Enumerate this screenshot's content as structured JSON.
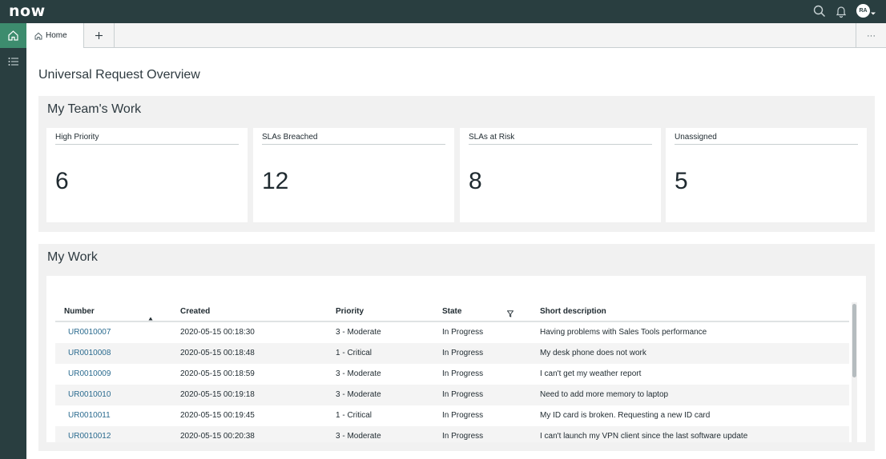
{
  "app": {
    "logo_text": "now",
    "avatar_initials": "RA"
  },
  "icons": {
    "search": "search-icon",
    "bell": "bell-icon",
    "home": "home-icon",
    "list": "list-icon",
    "add": "plus-icon",
    "more": "more-icon",
    "sort": "sort-ascending-icon",
    "filter": "filter-icon"
  },
  "colors": {
    "topbar": "#293e40",
    "rail_active": "#3d8c6e",
    "link": "#2b6b8f"
  },
  "tabs": {
    "home_label": "Home",
    "more_label": "···"
  },
  "page": {
    "title": "Universal Request Overview"
  },
  "team": {
    "title": "My Team's Work",
    "cards": [
      {
        "label": "High Priority",
        "value": "6"
      },
      {
        "label": "SLAs Breached",
        "value": "12"
      },
      {
        "label": "SLAs at Risk",
        "value": "8"
      },
      {
        "label": "Unassigned",
        "value": "5"
      }
    ]
  },
  "work": {
    "title": "My Work",
    "columns": [
      "Number",
      "Created",
      "Priority",
      "State",
      "Short description"
    ],
    "rows": [
      {
        "number": "UR0010007",
        "created": "2020-05-15 00:18:30",
        "priority": "3 - Moderate",
        "state": "In Progress",
        "desc": "Having problems with Sales Tools performance"
      },
      {
        "number": "UR0010008",
        "created": "2020-05-15 00:18:48",
        "priority": "1 - Critical",
        "state": "In Progress",
        "desc": "My desk phone does not work"
      },
      {
        "number": "UR0010009",
        "created": "2020-05-15 00:18:59",
        "priority": "3 - Moderate",
        "state": "In Progress",
        "desc": "I can't get my weather report"
      },
      {
        "number": "UR0010010",
        "created": "2020-05-15 00:19:18",
        "priority": "3 - Moderate",
        "state": "In Progress",
        "desc": "Need to add more memory to laptop"
      },
      {
        "number": "UR0010011",
        "created": "2020-05-15 00:19:45",
        "priority": "1 - Critical",
        "state": "In Progress",
        "desc": "My ID card is broken. Requesting a new ID card"
      },
      {
        "number": "UR0010012",
        "created": "2020-05-15 00:20:38",
        "priority": "3 - Moderate",
        "state": "In Progress",
        "desc": "I can't launch my VPN client since the last software update"
      }
    ]
  }
}
